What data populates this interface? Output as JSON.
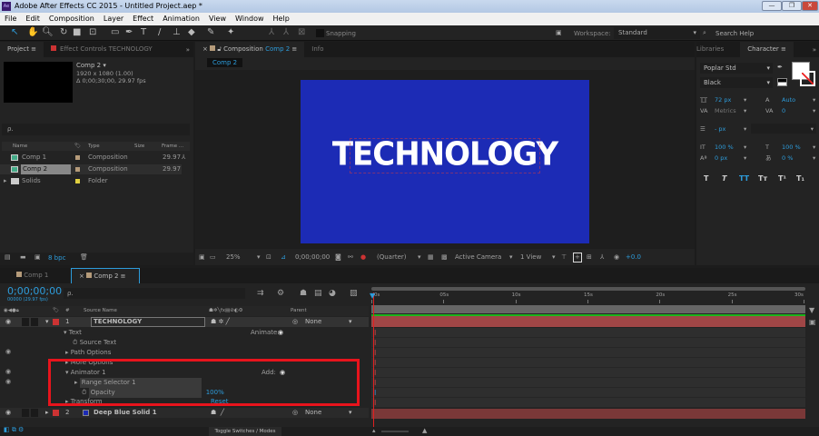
{
  "window": {
    "title": "Adobe After Effects CC 2015 - Untitled Project.aep *",
    "app_icon": "Ae",
    "minimize": "—",
    "maximize": "❐",
    "close": "✕"
  },
  "menu": [
    "File",
    "Edit",
    "Composition",
    "Layer",
    "Effect",
    "Animation",
    "View",
    "Window",
    "Help"
  ],
  "toolbar": {
    "snapping": "Snapping",
    "workspace_label": "Workspace:",
    "workspace_value": "Standard",
    "search_help": "Search Help"
  },
  "project": {
    "tab": "Project",
    "effect_tab": "Effect Controls TECHNOLOGY",
    "comp_name": "Comp 2 ▾",
    "comp_res": "1920 x 1080 (1.00)",
    "comp_dur": "Δ 0;00;30;00, 29.97 fps",
    "search_placeholder": "ρ.",
    "columns": [
      "Name",
      "Type",
      "Size",
      "Frame ..."
    ],
    "items": [
      {
        "name": "Comp 1",
        "type": "Composition",
        "fps": "29.97",
        "color": "#b59b7a"
      },
      {
        "name": "Comp 2",
        "type": "Composition",
        "fps": "29.97",
        "color": "#b59b7a"
      },
      {
        "name": "Solids",
        "type": "Folder",
        "fps": "",
        "color": "#e0d040"
      }
    ],
    "bpc": "8 bpc"
  },
  "composition": {
    "tab_prefix": "Composition",
    "tab_name": "Comp 2",
    "info_tab": "Info",
    "breadcrumb": "Comp 2",
    "text": "TECHNOLOGY",
    "bg_color": "#1c2bb5",
    "footer": {
      "zoom": "25%",
      "timecode": "0;00;00;00",
      "resolution": "(Quarter)",
      "camera": "Active Camera",
      "views": "1 View",
      "exposure": "+0.0"
    }
  },
  "character": {
    "libraries_tab": "Libraries",
    "tab": "Character",
    "font": "Poplar Std",
    "style": "Black",
    "size": "72 px",
    "leading": "Auto",
    "kerning": "Metrics",
    "tracking": "0",
    "stroke": "- px",
    "vscale": "100 %",
    "hscale": "100 %",
    "baseline": "0 px",
    "tsume": "0 %",
    "styles": [
      "T",
      "T",
      "TT",
      "Tт",
      "T¹",
      "T₁"
    ]
  },
  "timeline": {
    "tabs": [
      "Comp 1",
      "Comp 2"
    ],
    "timecode": "0;00;00;00",
    "frame_info": "00000 (29.97 fps)",
    "columns": {
      "source": "Source Name",
      "parent": "Parent"
    },
    "ruler": [
      "0s",
      "05s",
      "10s",
      "15s",
      "20s",
      "25s",
      "30s"
    ],
    "layers": [
      {
        "num": "1",
        "name": "TECHNOLOGY",
        "parent": "None"
      },
      {
        "num": "2",
        "name": "Deep Blue Solid 1",
        "parent": "None"
      }
    ],
    "props": {
      "text": "Text",
      "animate": "Animate:",
      "source_text": "Source Text",
      "path_options": "Path Options",
      "more_options": "More Options",
      "animator": "Animator 1",
      "add": "Add:",
      "range_selector": "Range Selector 1",
      "opacity": "Opacity",
      "opacity_value": "100%",
      "transform": "Transform",
      "reset": "Reset"
    },
    "toggle": "Toggle Switches / Modes"
  }
}
